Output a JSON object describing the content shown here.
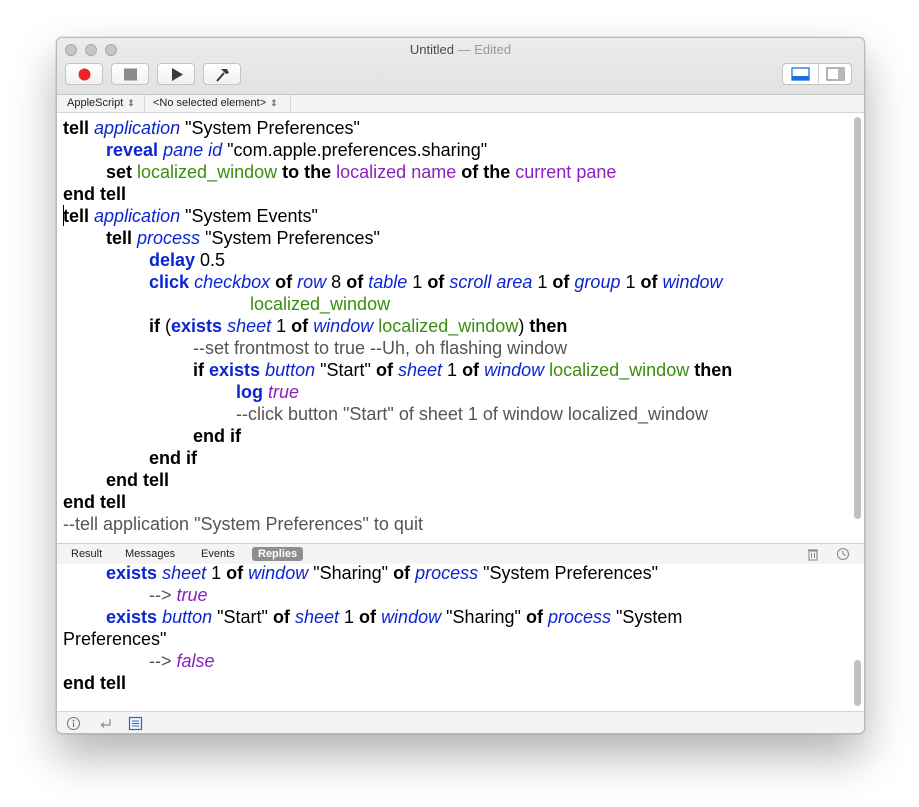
{
  "window": {
    "title": "Untitled",
    "title_sep": " — ",
    "title_status": "Edited"
  },
  "toolbar": {
    "record_icon": "record-icon",
    "stop_icon": "stop-icon",
    "run_icon": "run-icon",
    "compile_icon": "hammer-icon",
    "view_left_icon": "bottom-pane-icon",
    "view_right_icon": "side-pane-icon"
  },
  "navbar": {
    "language": "AppleScript",
    "element": "<No selected element>"
  },
  "code": {
    "l1": [
      "tell",
      "application",
      "\"System Preferences\""
    ],
    "l2": [
      "reveal",
      "pane",
      "id",
      "\"com.apple.preferences.sharing\""
    ],
    "l3": [
      "set",
      "localized_window",
      "to the",
      "localized",
      "name",
      "of the",
      "current",
      "pane"
    ],
    "l4": [
      "end tell"
    ],
    "l5": [
      "tell",
      "application",
      "\"System Events\""
    ],
    "l6": [
      "tell",
      "process",
      "\"System Preferences\""
    ],
    "l7": [
      "delay",
      "0.5"
    ],
    "l8": [
      "click",
      "checkbox",
      "of",
      "row",
      "8",
      "of",
      "table",
      "1",
      "of",
      "scroll area",
      "1",
      "of",
      "group",
      "1",
      "of",
      "window"
    ],
    "l9": [
      "localized_window"
    ],
    "l10": [
      "if",
      "(",
      "exists",
      "sheet",
      "1",
      "of",
      "window",
      "localized_window",
      ")",
      "then"
    ],
    "l11": [
      "--set frontmost to true --Uh, oh flashing window"
    ],
    "l12": [
      "if",
      "exists",
      "button",
      "\"Start\"",
      "of",
      "sheet",
      "1",
      "of",
      "window",
      "localized_window",
      "then"
    ],
    "l13": [
      "log",
      "true"
    ],
    "l14": [
      "--click button \"Start\" of sheet 1 of window localized_window"
    ],
    "l15": [
      "end if"
    ],
    "l16": [
      "end if"
    ],
    "l17": [
      "end tell"
    ],
    "l18": [
      "end tell"
    ],
    "l19": [
      "--tell application \"System Preferences\" to quit"
    ]
  },
  "log_tabs": {
    "result": "Result",
    "messages": "Messages",
    "events": "Events",
    "replies": "Replies",
    "active": "Replies"
  },
  "log": {
    "r1": [
      "exists",
      "sheet",
      "1",
      "of",
      "window",
      "\"Sharing\"",
      "of",
      "process",
      "\"System Preferences\""
    ],
    "r2": [
      "-->",
      "true"
    ],
    "r3": [
      "exists",
      "button",
      "\"Start\"",
      "of",
      "sheet",
      "1",
      "of",
      "window",
      "\"Sharing\"",
      "of",
      "process",
      "\"System"
    ],
    "r4": [
      "Preferences\""
    ],
    "r5": [
      "-->",
      "false"
    ],
    "r6": [
      "end tell"
    ]
  },
  "statusbar": {
    "info_icon": "info-icon",
    "return_icon": "return-arrow-icon",
    "list_icon": "list-icon"
  },
  "colors": {
    "keyword": "#000000",
    "class": "#0b25d1",
    "variable": "#3b8d0e",
    "property": "#8d1fc1",
    "comment": "#555555",
    "record": "#e8262b"
  }
}
